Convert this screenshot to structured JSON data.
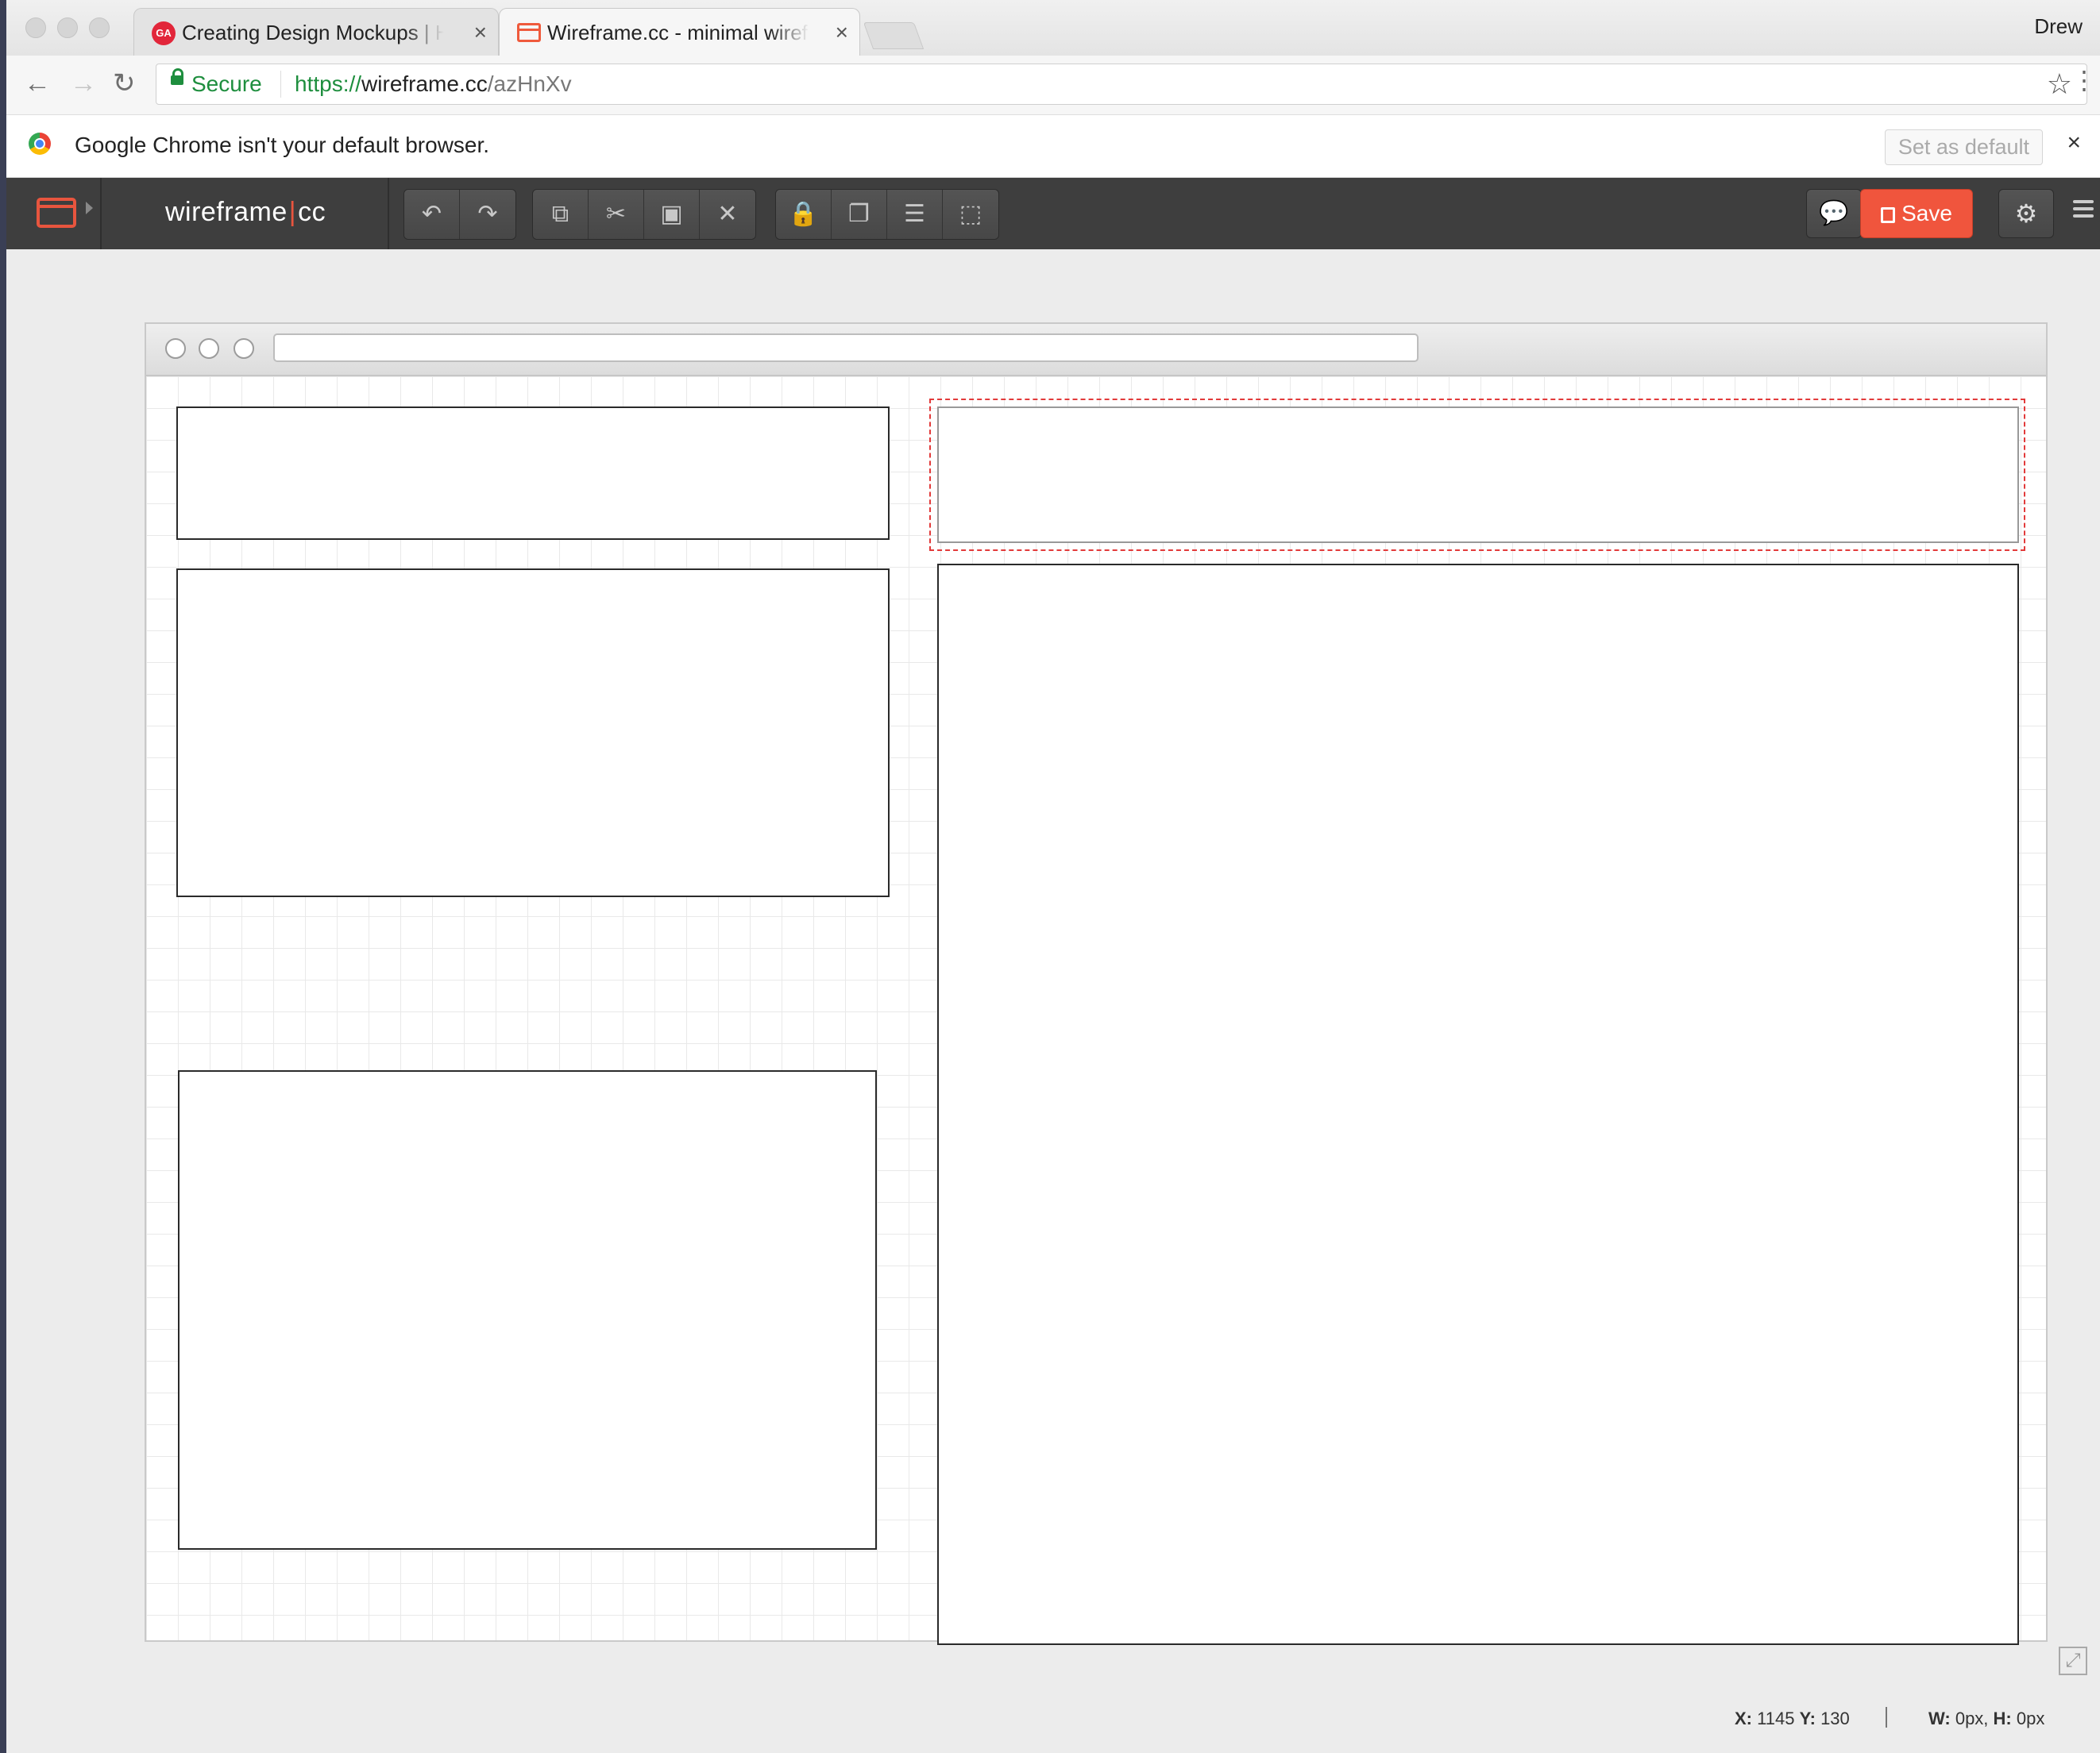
{
  "browser": {
    "tabs": [
      {
        "title": "Creating Design Mockups | HTML",
        "close": "×",
        "favicon": "GA"
      },
      {
        "title": "Wireframe.cc - minimal wireframing tool",
        "close": "×"
      }
    ],
    "profile": "Drew",
    "security_label": "Secure",
    "url": {
      "scheme": "https://",
      "host": "wireframe.cc",
      "path": "/azHnXv"
    },
    "nav": {
      "back": "←",
      "forward": "→",
      "reload": "↻"
    },
    "star": "☆",
    "menu": "⋮"
  },
  "infobar": {
    "message": "Google Chrome isn't your default browser.",
    "action": "Set as default",
    "close": "×"
  },
  "app": {
    "brand_left": "wireframe",
    "brand_sep": "|",
    "brand_right": "cc",
    "toolbar": {
      "undo": "↶",
      "redo": "↷",
      "copy": "⧉",
      "cut": "✂",
      "paste": "▣",
      "delete": "✕",
      "lock": "🔒",
      "arrange": "❐",
      "align": "☰",
      "group": "⬚"
    },
    "comment_icon": "💬",
    "save_label": "Save",
    "settings_icon": "⚙",
    "accent_color": "#f0553d"
  },
  "status": {
    "x_label": "X:",
    "x_value": "1145",
    "y_label": "Y:",
    "y_value": "130",
    "w_label": "W:",
    "w_value": "0px,",
    "h_label": "H:",
    "h_value": "0px"
  }
}
